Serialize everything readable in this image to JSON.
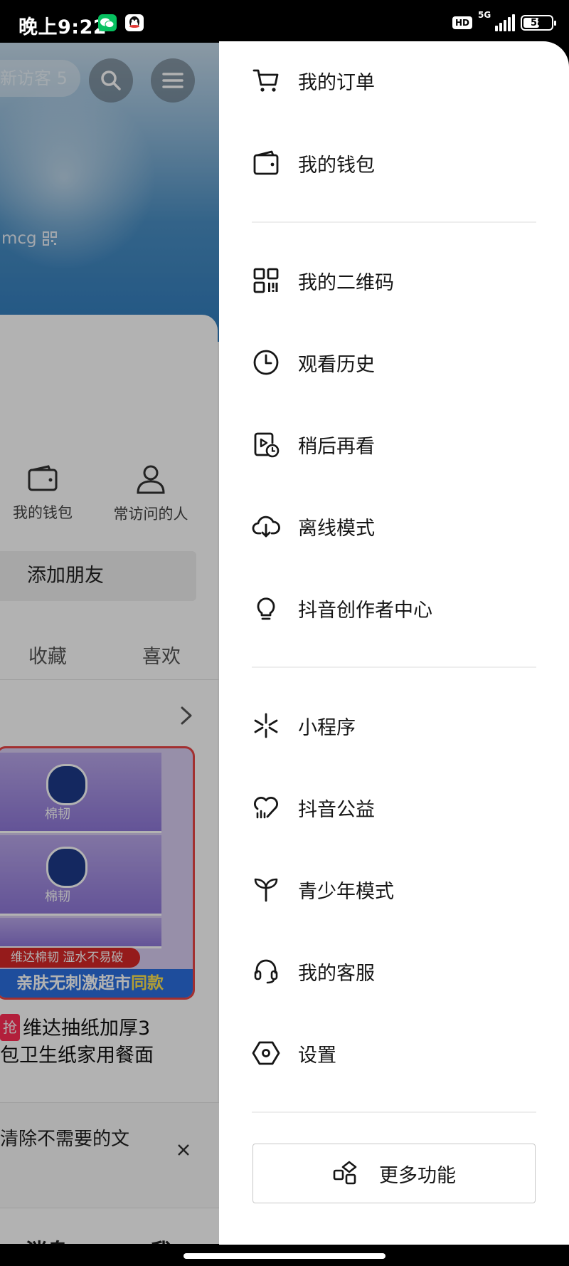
{
  "status_bar": {
    "time": "晚上9:22",
    "hd": "HD",
    "network": "5G",
    "battery": "58",
    "battery_level": 0.58
  },
  "background": {
    "visitor_pill": "新访客 5",
    "username": "mcg",
    "quick_items": [
      {
        "label": "我的钱包",
        "icon": "wallet-icon"
      },
      {
        "label": "常访问的人",
        "icon": "person-icon"
      }
    ],
    "add_friend": "添加朋友",
    "tabs": [
      "收藏",
      "喜欢"
    ],
    "product": {
      "tag": "抢",
      "title_line1": "维达抽纸加厚3",
      "title_line2": "包卫生纸家用餐面",
      "brand": "棉韧",
      "promo1": "维达棉韧 湿水不易破",
      "promo2_main": "亲肤无刺激超市",
      "promo2_highlight": "同款"
    },
    "clean_text": "清除不需要的文",
    "bottom_nav": [
      "消息",
      "我"
    ]
  },
  "drawer": {
    "group1": [
      {
        "label": "我的订单",
        "icon": "cart-icon"
      },
      {
        "label": "我的钱包",
        "icon": "wallet-icon"
      }
    ],
    "group2": [
      {
        "label": "我的二维码",
        "icon": "qrcode-icon"
      },
      {
        "label": "观看历史",
        "icon": "clock-icon"
      },
      {
        "label": "稍后再看",
        "icon": "watch-later-icon"
      },
      {
        "label": "离线模式",
        "icon": "cloud-download-icon"
      },
      {
        "label": "抖音创作者中心",
        "icon": "lightbulb-icon"
      }
    ],
    "group3": [
      {
        "label": "小程序",
        "icon": "mini-program-icon"
      },
      {
        "label": "抖音公益",
        "icon": "charity-heart-icon"
      },
      {
        "label": "青少年模式",
        "icon": "sprout-icon"
      },
      {
        "label": "我的客服",
        "icon": "headset-icon"
      },
      {
        "label": "设置",
        "icon": "settings-hex-icon"
      }
    ],
    "more_button": "更多功能"
  },
  "colors": {
    "drawer_bg": "#ffffff",
    "text_primary": "#161616",
    "divider": "#eeeeee",
    "promo_red": "#d62828",
    "promo_blue": "#2b6fe0"
  }
}
